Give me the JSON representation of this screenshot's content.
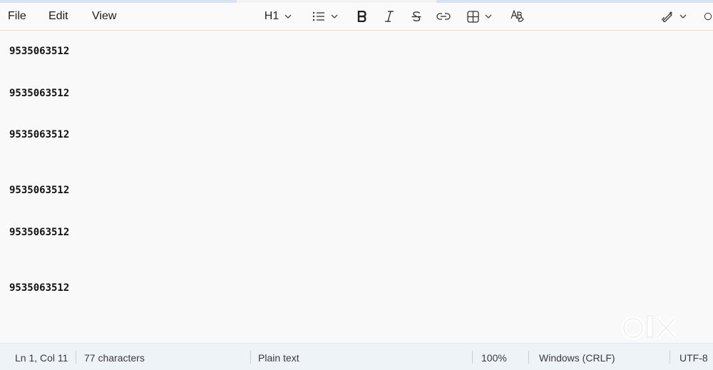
{
  "menu": {
    "file": "File",
    "edit": "Edit",
    "view": "View"
  },
  "toolbar": {
    "heading_label": "H1",
    "icons": [
      "chevron-down-icon",
      "bulleted-list-icon",
      "bold-icon",
      "italic-icon",
      "strikethrough-icon",
      "link-icon",
      "table-icon",
      "clear-formatting-icon",
      "copilot-rewrite-icon"
    ]
  },
  "document": {
    "lines": [
      "9535063512",
      "9535063512",
      "9535063512",
      "9535063512",
      "9535063512",
      "9535063512"
    ]
  },
  "status": {
    "position": "Ln 1, Col 11",
    "characters": "77 characters",
    "format": "Plain text",
    "zoom": "100%",
    "line_ending": "Windows (CRLF)",
    "encoding": "UTF-8"
  },
  "colors": {
    "menubar_bg": "#fafafa",
    "editor_bg": "#f9f9f9",
    "statusbar_bg": "#eef3f8",
    "accent_strip": "#d5e4f0"
  }
}
